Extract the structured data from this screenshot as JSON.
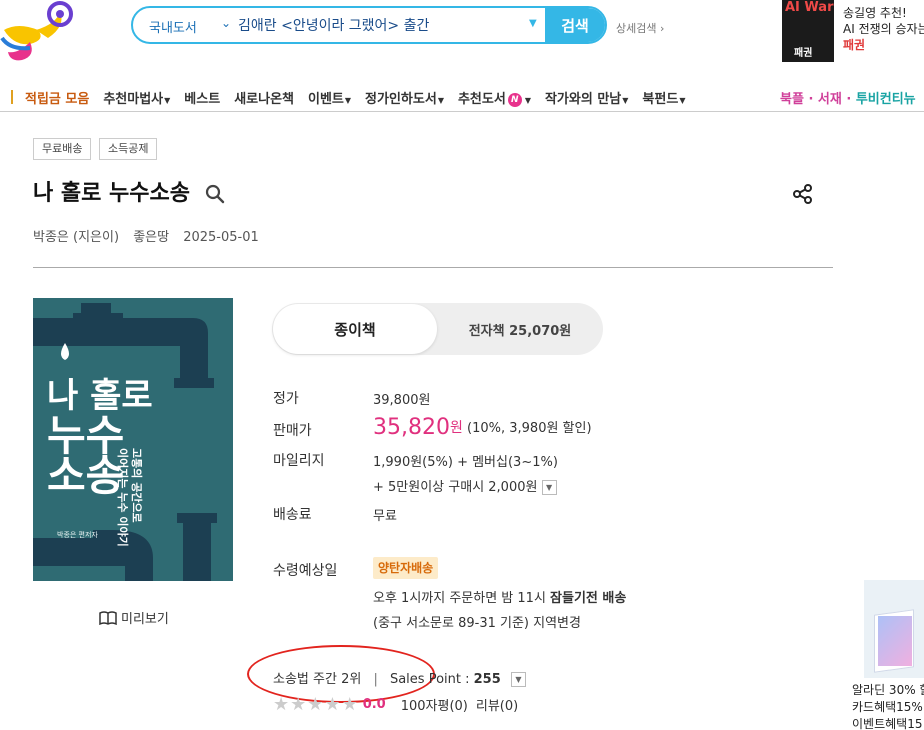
{
  "header": {
    "search_category": "국내도서",
    "search_value": "김애란 <안녕이라 그랬어> 출간",
    "search_button": "검색",
    "advanced_search": "상세검색"
  },
  "ad_top": {
    "book_title": "AI War",
    "book_subtitle": "패권",
    "line1": "송길영 추천!",
    "line2": "AI 전쟁의 승자는",
    "line3": "패권"
  },
  "nav": {
    "items": [
      "적립금 모음",
      "추천마법사",
      "베스트",
      "새로나온책",
      "이벤트",
      "정가인하도서",
      "추천도서",
      "작가와의 만남",
      "북펀드"
    ],
    "badge": "N",
    "right_items": [
      "북플",
      "서재",
      "투비컨티뉴"
    ]
  },
  "product": {
    "tags": [
      "무료배송",
      "소득공제"
    ],
    "title": "나 홀로 누수소송",
    "author": "박종은 (지은이)",
    "publisher": "좋은땅",
    "date": "2025-05-01",
    "cover": {
      "title_lines": [
        "나 홀로",
        "누수",
        "소송"
      ],
      "subtitle": "고통의 공간으로",
      "tagline": "이어지는 누수 이야기",
      "author": "박종은 편저자"
    },
    "preview": "미리보기",
    "format_paper": "종이책",
    "format_ebook": "전자책 25,070원",
    "labels": {
      "list_price": "정가",
      "sale_price": "판매가",
      "mileage": "마일리지",
      "shipping": "배송료",
      "delivery_date": "수령예상일"
    },
    "list_price": "39,800원",
    "sale_price": "35,820",
    "sale_unit": "원",
    "discount": "(10%, 3,980원 할인)",
    "mileage_1": "1,990원(5%) + 멤버십(3~1%)",
    "mileage_2": "+ 5만원이상 구매시 2,000원",
    "shipping_value": "무료",
    "delivery_badge": "양탄자배송",
    "delivery_line1_pre": "오후 1시까지 주문하면 밤 11시",
    "delivery_line1_bold": "잠들기전 배송",
    "delivery_line2": "(중구 서소문로 89-31 기준) 지역변경",
    "sales_rank": "소송법 주간 2위",
    "sales_point_label": "Sales Point :",
    "sales_point_value": "255",
    "rating": "0.0",
    "rating_value": 0,
    "comments": "100자평(0)",
    "reviews": "리뷰(0)"
  },
  "ad_side": {
    "line1": "알라딘 30% 할",
    "line2": "카드혜택15%",
    "line3": "이벤트혜택15"
  },
  "colors": {
    "accent_blue": "#34b7e6",
    "price_pink": "#e0307e",
    "cover_teal": "#2f6b73",
    "highlight_red": "#e2241e"
  }
}
